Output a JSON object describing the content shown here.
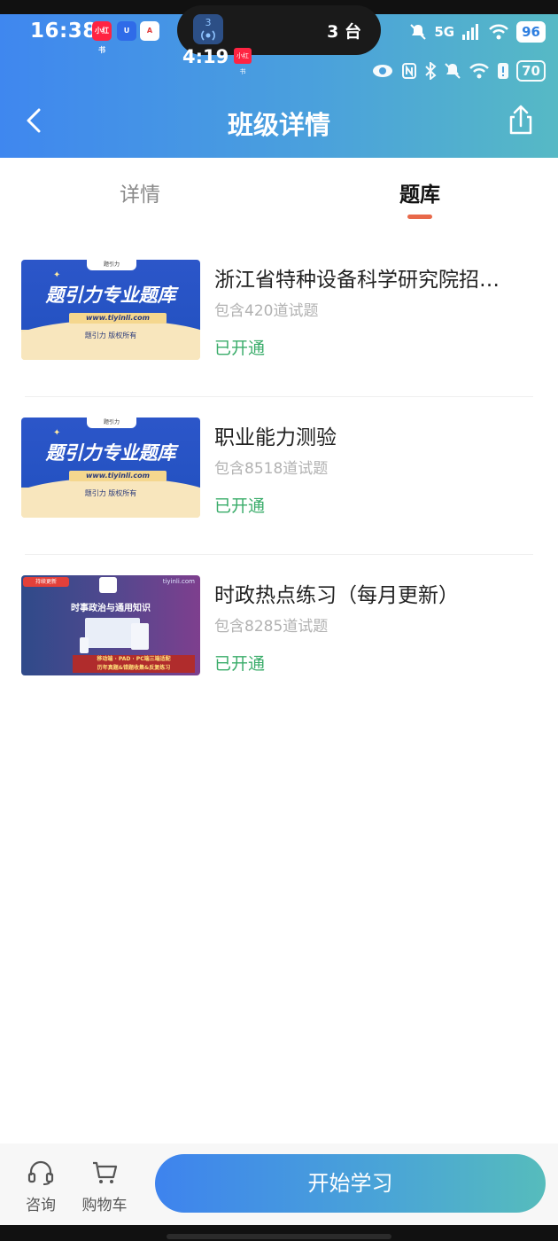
{
  "status_bar": {
    "time": "16:38",
    "app_badges": [
      "小红书",
      "U",
      "A"
    ],
    "island_icon_count": "3",
    "island_text": "3 台",
    "network": "5G",
    "battery": "96",
    "secondary_time": "4:19",
    "secondary_battery": "70"
  },
  "nav": {
    "title": "班级详情"
  },
  "tabs": [
    {
      "label": "详情",
      "active": false
    },
    {
      "label": "题库",
      "active": true
    }
  ],
  "items": [
    {
      "title": "浙江省特种设备科学研究院招…",
      "count": "包含420道试题",
      "status": "已开通",
      "thumb": {
        "logo": "题引力",
        "headline": "题引力专业题库",
        "url": "www.tiyinli.com",
        "copyright": "题引力 版权所有"
      }
    },
    {
      "title": "职业能力测验",
      "count": "包含8518道试题",
      "status": "已开通",
      "thumb": {
        "logo": "题引力",
        "headline": "题引力专业题库",
        "url": "www.tiyinli.com",
        "copyright": "题引力 版权所有"
      }
    },
    {
      "title": "时政热点练习（每月更新）",
      "count": "包含8285道试题",
      "status": "已开通",
      "thumb": {
        "tag": "持续更新",
        "site": "tiyinli.com",
        "headline": "时事政治与通用知识",
        "banner_line1": "移动端 · PAD · PC端三端适配",
        "banner_line2": "历年真题&错题收集&反复练习"
      }
    }
  ],
  "bottom": {
    "consult_label": "咨询",
    "cart_label": "购物车",
    "start_label": "开始学习"
  },
  "colors": {
    "accent_green": "#3aac6a",
    "tab_indicator": "#e8694a",
    "header_gradient_start": "#3f87ef",
    "header_gradient_end": "#56b9c5"
  }
}
